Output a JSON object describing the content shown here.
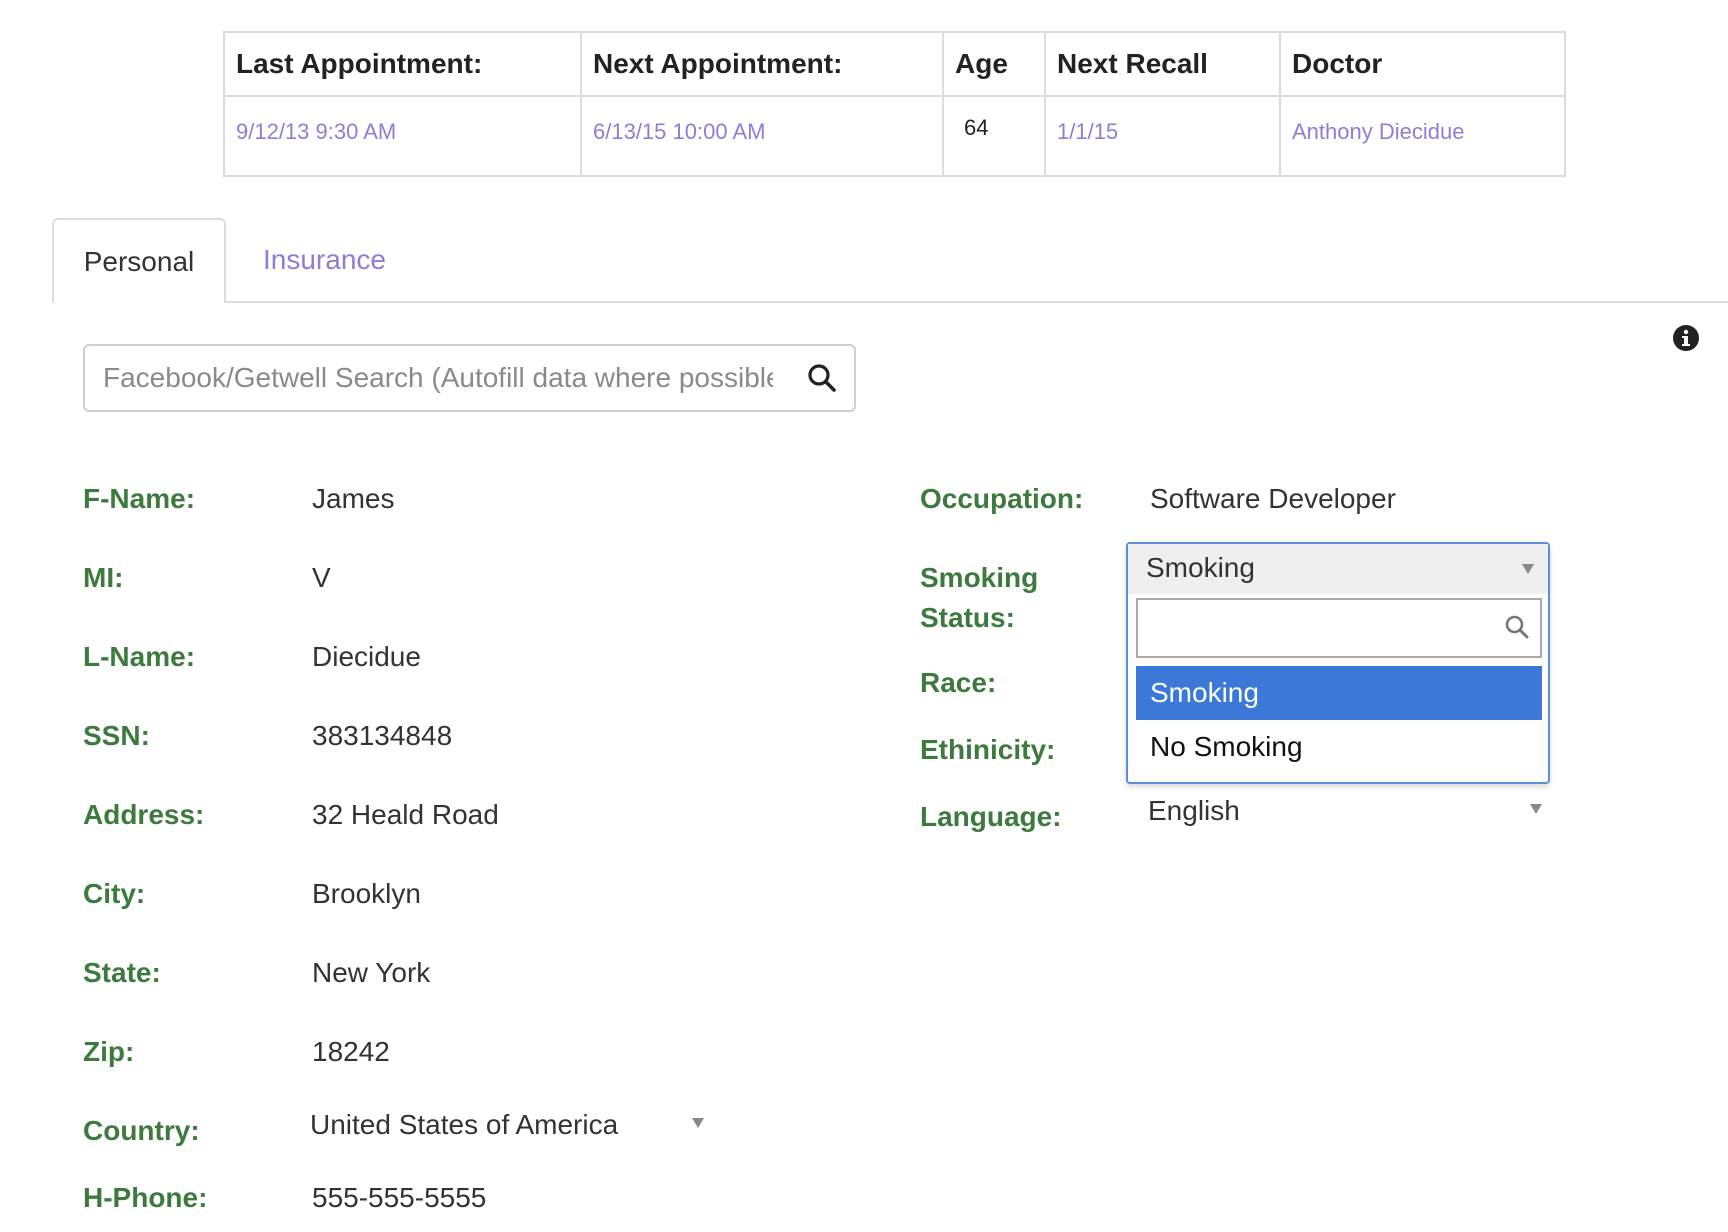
{
  "summary": {
    "headers": [
      "Last Appointment:",
      "Next Appointment:",
      "Age",
      "Next Recall",
      "Doctor"
    ],
    "last_appointment": "9/12/13  9:30 AM",
    "next_appointment": "6/13/15  10:00 AM",
    "age": "64",
    "next_recall": "1/1/15",
    "doctor": "Anthony Diecidue"
  },
  "tabs": {
    "active": "Personal",
    "other": "Insurance"
  },
  "search": {
    "placeholder": "Facebook/Getwell Search (Autofill data where possible)"
  },
  "left_fields": [
    {
      "label": "F-Name:",
      "value": "James"
    },
    {
      "label": "MI:",
      "value": "V"
    },
    {
      "label": "L-Name:",
      "value": "Diecidue"
    },
    {
      "label": "SSN:",
      "value": "383134848"
    },
    {
      "label": "Address:",
      "value": "32 Heald Road"
    },
    {
      "label": "City:",
      "value": "Brooklyn"
    },
    {
      "label": "State:",
      "value": "New York"
    },
    {
      "label": "Zip:",
      "value": "18242"
    },
    {
      "label": "Country:",
      "value": "United States of America"
    },
    {
      "label": "H-Phone:",
      "value": "555-555-5555"
    }
  ],
  "right_fields": {
    "occupation_label": "Occupation:",
    "occupation_value": "Software Developer",
    "smoking_label_1": "Smoking",
    "smoking_label_2": "Status:",
    "race_label": "Race:",
    "ethnicity_label": "Ethinicity:",
    "language_label": "Language:",
    "language_value": "English"
  },
  "smoking_dropdown": {
    "selected": "Smoking",
    "options": [
      "Smoking",
      "No Smoking"
    ]
  },
  "colors": {
    "label_green": "#3d7a3d",
    "link_purple": "#8b7fd6",
    "highlight_blue": "#3b78d8"
  },
  "icons": {
    "info": "info-circle-icon",
    "search": "magnifier-icon"
  }
}
